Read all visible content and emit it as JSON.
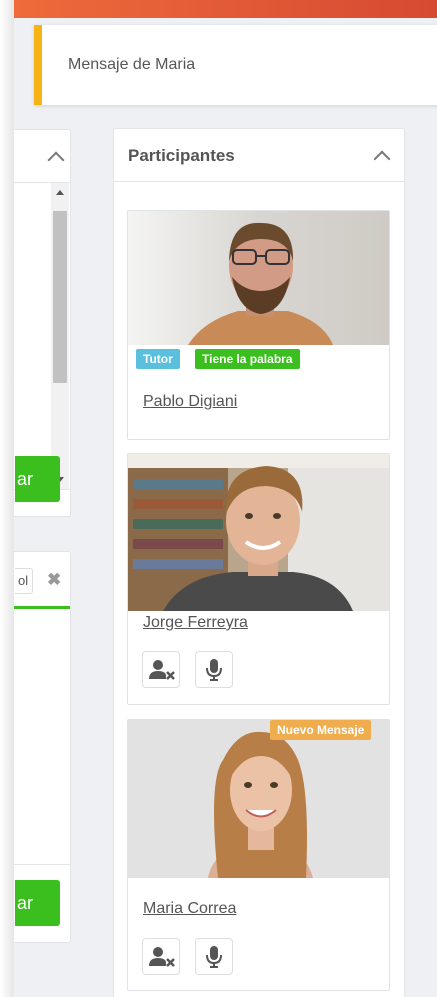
{
  "toast": {
    "message": "Mensaje de Maria"
  },
  "left_panel_top": {
    "button_label": "ar"
  },
  "left_panel_bottom": {
    "input_value": "ol",
    "close_glyph": "✖",
    "button_label": "ar"
  },
  "participants": {
    "title": "Participantes",
    "people": [
      {
        "name": "Pablo Digiani",
        "badges": [
          "Tutor",
          "Tiene la palabra"
        ]
      },
      {
        "name": "Jorge Ferreyra",
        "badges": []
      },
      {
        "name": "Maria Correa",
        "badges": [
          "Nuevo Mensaje"
        ]
      }
    ]
  },
  "colors": {
    "accent_green": "#3bbf1e",
    "tutor_badge": "#5bc0de",
    "floor_badge": "#3bbf1e",
    "new_message_badge": "#f0ad4e",
    "toast_border": "#f5b316",
    "top_bar": "#e2553a"
  },
  "icons": {
    "remove_user": "user-times-icon",
    "microphone": "microphone-icon",
    "collapse": "chevron-up-icon"
  }
}
